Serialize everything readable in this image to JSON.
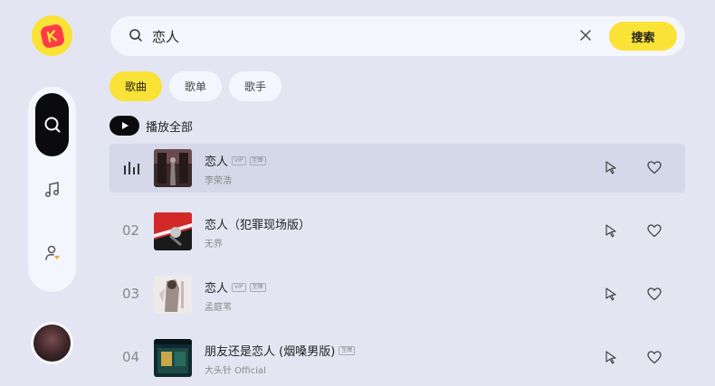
{
  "search": {
    "query": "恋人",
    "button_label": "搜索"
  },
  "tabs": [
    {
      "label": "歌曲",
      "active": true
    },
    {
      "label": "歌单",
      "active": false
    },
    {
      "label": "歌手",
      "active": false
    }
  ],
  "play_all_label": "播放全部",
  "badges": {
    "vip": "VIP",
    "exclusive": "至臻"
  },
  "songs": [
    {
      "index": "",
      "playing": true,
      "title": "恋人",
      "artist": "李荣浩",
      "badges": [
        "VIP",
        "至臻"
      ]
    },
    {
      "index": "02",
      "playing": false,
      "title": "恋人（犯罪现场版）",
      "artist": "无界",
      "badges": []
    },
    {
      "index": "03",
      "playing": false,
      "title": "恋人",
      "artist": "孟庭苇",
      "badges": [
        "VIP",
        "至臻"
      ]
    },
    {
      "index": "04",
      "playing": false,
      "title": "朋友还是恋人 (烟嗓男版)",
      "artist": "大头针 Official",
      "badges": [
        "至臻"
      ]
    }
  ],
  "colors": {
    "accent": "#fbe236",
    "background": "#e3e6f2",
    "panel": "#f4f6fd",
    "active_row": "#d4d8e8"
  },
  "icons": [
    "app-logo-icon",
    "search-icon",
    "music-note-icon",
    "user-icon",
    "clear-icon",
    "play-icon",
    "playing-bars-icon",
    "pointer-icon",
    "heart-icon"
  ]
}
